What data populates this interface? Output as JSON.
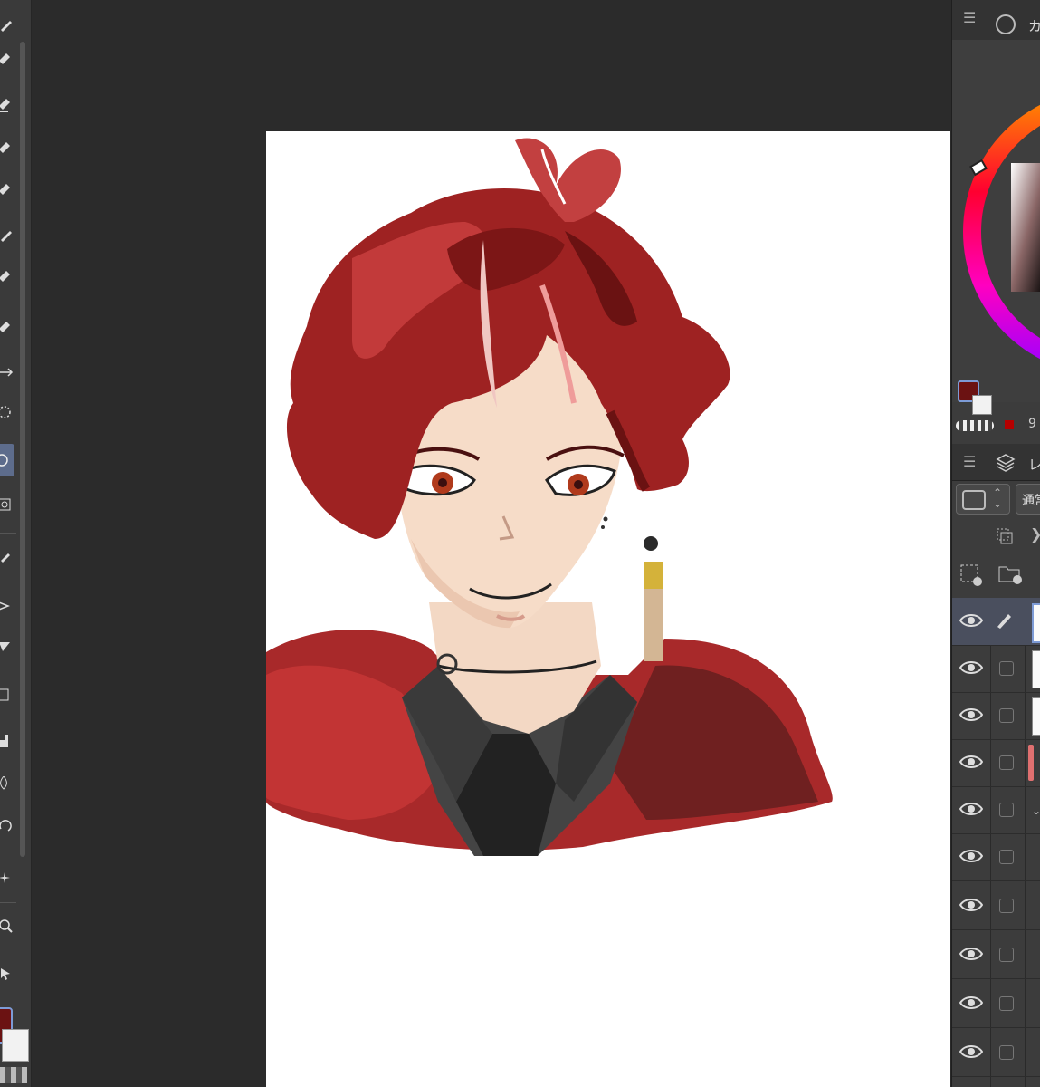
{
  "right_panel": {
    "color_tab_label": "カ",
    "color_value_text": "9",
    "layer_tab_label": "レ",
    "blend_mode_label": "通常",
    "layer_count": 10
  },
  "colors": {
    "main_color": "#6b1212",
    "sub_color": "#f2f2f2",
    "active_tool": "#5d6c8c"
  },
  "icons": {
    "toolbar": [
      "pen-icon",
      "pencil-icon",
      "brush-icon",
      "airbrush-icon",
      "decoration-icon",
      "eraser-icon",
      "blend-icon",
      "move-icon",
      "lasso-icon",
      "selection-icon",
      "magic-wand-icon",
      "eyedropper-icon",
      "text-icon",
      "gradient-icon",
      "fill-icon",
      "ruler-icon",
      "figure-icon",
      "frame-icon",
      "transform-icon",
      "zoom-icon",
      "hand-icon"
    ]
  }
}
